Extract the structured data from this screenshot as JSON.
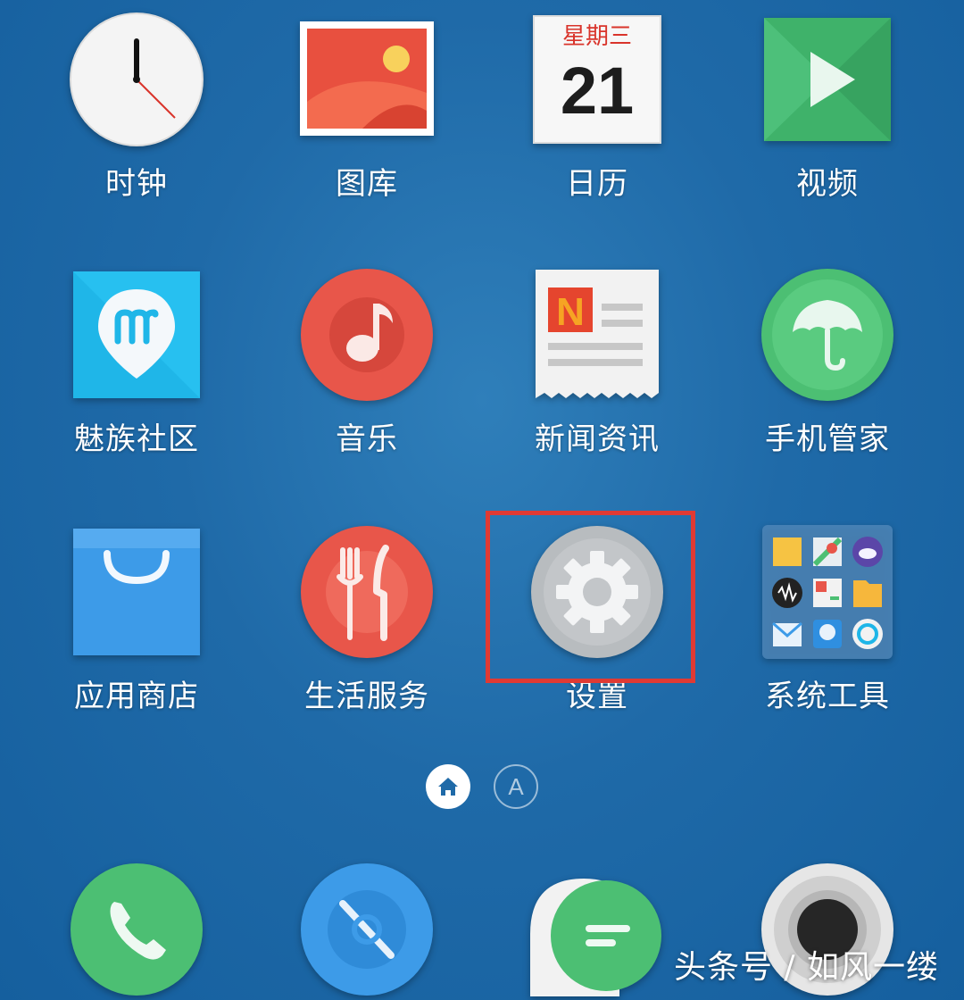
{
  "apps": {
    "clock": {
      "label": "时钟",
      "icon": "clock-icon"
    },
    "gallery": {
      "label": "图库",
      "icon": "gallery-icon"
    },
    "calendar": {
      "label": "日历",
      "icon": "calendar-icon",
      "weekday": "星期三",
      "date": "21"
    },
    "video": {
      "label": "视频",
      "icon": "video-icon"
    },
    "community": {
      "label": "魅族社区",
      "icon": "meizu-community-icon"
    },
    "music": {
      "label": "音乐",
      "icon": "music-icon"
    },
    "news": {
      "label": "新闻资讯",
      "icon": "news-icon"
    },
    "phone_manager": {
      "label": "手机管家",
      "icon": "umbrella-icon"
    },
    "app_store": {
      "label": "应用商店",
      "icon": "shopping-bag-icon"
    },
    "life_services": {
      "label": "生活服务",
      "icon": "fork-knife-icon"
    },
    "settings": {
      "label": "设置",
      "icon": "gear-icon"
    },
    "system_tools": {
      "label": "系统工具",
      "icon": "folder-grid-icon"
    }
  },
  "page_indicator": {
    "current": "home",
    "alt_label": "A"
  },
  "dock": [
    "phone-icon",
    "browser-icon",
    "messages-icon",
    "camera-icon"
  ],
  "watermark": "头条号 / 如风一缕",
  "colors": {
    "highlight": "#e03a34",
    "clock_hand": "#d9342b",
    "gallery": "#e8503f",
    "video": "#3fb26a",
    "community": "#1fb6e8",
    "music": "#e8564a",
    "phone_manager": "#4cbf73",
    "app_store": "#3d9be8",
    "settings": "#b8bcbf"
  }
}
